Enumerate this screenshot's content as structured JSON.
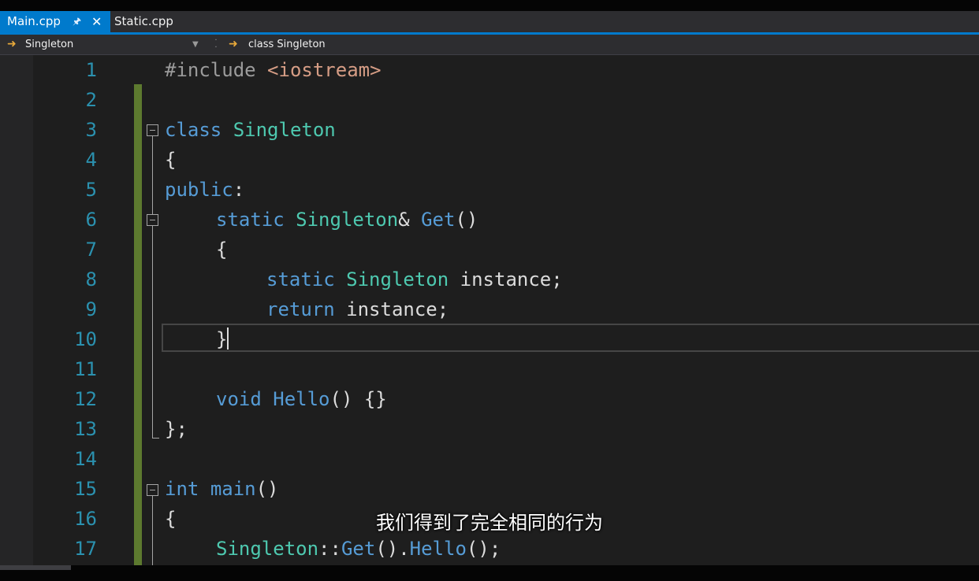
{
  "tabs": [
    {
      "label": "Main.cpp",
      "active": true,
      "pin_icon": "pin-icon",
      "close_icon": "close-icon"
    },
    {
      "label": "Static.cpp",
      "active": false
    }
  ],
  "navbar": {
    "scope": "Singleton",
    "member": "class Singleton"
  },
  "line_numbers": [
    "1",
    "2",
    "3",
    "4",
    "5",
    "6",
    "7",
    "8",
    "9",
    "10",
    "11",
    "12",
    "13",
    "14",
    "15",
    "16",
    "17"
  ],
  "code_tokens": {
    "l1": {
      "pp": "#include",
      "sp": " ",
      "hdr": "<iostream>"
    },
    "l3": {
      "kw": "class",
      "sp": " ",
      "ty": "Singleton"
    },
    "l4": {
      "p": "{"
    },
    "l5": {
      "kw": "public",
      "p": ":"
    },
    "l6": {
      "kw": "static",
      "sp": " ",
      "ty": "Singleton",
      "amp": "& ",
      "fn": "Get",
      "p": "()"
    },
    "l7": {
      "p": "{"
    },
    "l8": {
      "kw": "static",
      "sp": " ",
      "ty": "Singleton",
      "rest": " instance;"
    },
    "l9": {
      "kw": "return",
      "rest": " instance;"
    },
    "l10": {
      "p": "}"
    },
    "l12": {
      "kw": "void",
      "sp": " ",
      "fn": "Hello",
      "p": "() {}"
    },
    "l13": {
      "p": "};"
    },
    "l15": {
      "kw": "int",
      "sp": " ",
      "fn": "main",
      "p": "()"
    },
    "l16": {
      "p": "{"
    },
    "l17": {
      "ty": "Singleton",
      "p1": "::",
      "fn1": "Get",
      "p2": "().",
      "fn2": "Hello",
      "p3": "();"
    }
  },
  "subtitle": "我们得到了完全相同的行为",
  "colors": {
    "accent": "#007acc",
    "keyword": "#569cd6",
    "type": "#4ec9b0",
    "line_number": "#2b91af",
    "change_bar": "#57a64a"
  }
}
